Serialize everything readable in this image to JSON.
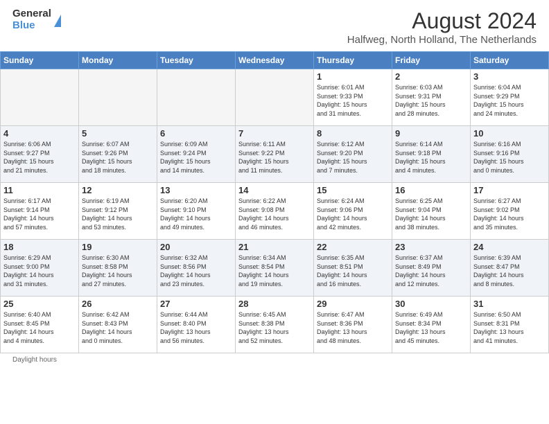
{
  "logo": {
    "general": "General",
    "blue": "Blue"
  },
  "header": {
    "month": "August 2024",
    "location": "Halfweg, North Holland, The Netherlands"
  },
  "days_of_week": [
    "Sunday",
    "Monday",
    "Tuesday",
    "Wednesday",
    "Thursday",
    "Friday",
    "Saturday"
  ],
  "footer": {
    "note": "Daylight hours"
  },
  "weeks": [
    {
      "row_alt": false,
      "days": [
        {
          "num": "",
          "info": ""
        },
        {
          "num": "",
          "info": ""
        },
        {
          "num": "",
          "info": ""
        },
        {
          "num": "",
          "info": ""
        },
        {
          "num": "1",
          "info": "Sunrise: 6:01 AM\nSunset: 9:33 PM\nDaylight: 15 hours\nand 31 minutes."
        },
        {
          "num": "2",
          "info": "Sunrise: 6:03 AM\nSunset: 9:31 PM\nDaylight: 15 hours\nand 28 minutes."
        },
        {
          "num": "3",
          "info": "Sunrise: 6:04 AM\nSunset: 9:29 PM\nDaylight: 15 hours\nand 24 minutes."
        }
      ]
    },
    {
      "row_alt": true,
      "days": [
        {
          "num": "4",
          "info": "Sunrise: 6:06 AM\nSunset: 9:27 PM\nDaylight: 15 hours\nand 21 minutes."
        },
        {
          "num": "5",
          "info": "Sunrise: 6:07 AM\nSunset: 9:26 PM\nDaylight: 15 hours\nand 18 minutes."
        },
        {
          "num": "6",
          "info": "Sunrise: 6:09 AM\nSunset: 9:24 PM\nDaylight: 15 hours\nand 14 minutes."
        },
        {
          "num": "7",
          "info": "Sunrise: 6:11 AM\nSunset: 9:22 PM\nDaylight: 15 hours\nand 11 minutes."
        },
        {
          "num": "8",
          "info": "Sunrise: 6:12 AM\nSunset: 9:20 PM\nDaylight: 15 hours\nand 7 minutes."
        },
        {
          "num": "9",
          "info": "Sunrise: 6:14 AM\nSunset: 9:18 PM\nDaylight: 15 hours\nand 4 minutes."
        },
        {
          "num": "10",
          "info": "Sunrise: 6:16 AM\nSunset: 9:16 PM\nDaylight: 15 hours\nand 0 minutes."
        }
      ]
    },
    {
      "row_alt": false,
      "days": [
        {
          "num": "11",
          "info": "Sunrise: 6:17 AM\nSunset: 9:14 PM\nDaylight: 14 hours\nand 57 minutes."
        },
        {
          "num": "12",
          "info": "Sunrise: 6:19 AM\nSunset: 9:12 PM\nDaylight: 14 hours\nand 53 minutes."
        },
        {
          "num": "13",
          "info": "Sunrise: 6:20 AM\nSunset: 9:10 PM\nDaylight: 14 hours\nand 49 minutes."
        },
        {
          "num": "14",
          "info": "Sunrise: 6:22 AM\nSunset: 9:08 PM\nDaylight: 14 hours\nand 46 minutes."
        },
        {
          "num": "15",
          "info": "Sunrise: 6:24 AM\nSunset: 9:06 PM\nDaylight: 14 hours\nand 42 minutes."
        },
        {
          "num": "16",
          "info": "Sunrise: 6:25 AM\nSunset: 9:04 PM\nDaylight: 14 hours\nand 38 minutes."
        },
        {
          "num": "17",
          "info": "Sunrise: 6:27 AM\nSunset: 9:02 PM\nDaylight: 14 hours\nand 35 minutes."
        }
      ]
    },
    {
      "row_alt": true,
      "days": [
        {
          "num": "18",
          "info": "Sunrise: 6:29 AM\nSunset: 9:00 PM\nDaylight: 14 hours\nand 31 minutes."
        },
        {
          "num": "19",
          "info": "Sunrise: 6:30 AM\nSunset: 8:58 PM\nDaylight: 14 hours\nand 27 minutes."
        },
        {
          "num": "20",
          "info": "Sunrise: 6:32 AM\nSunset: 8:56 PM\nDaylight: 14 hours\nand 23 minutes."
        },
        {
          "num": "21",
          "info": "Sunrise: 6:34 AM\nSunset: 8:54 PM\nDaylight: 14 hours\nand 19 minutes."
        },
        {
          "num": "22",
          "info": "Sunrise: 6:35 AM\nSunset: 8:51 PM\nDaylight: 14 hours\nand 16 minutes."
        },
        {
          "num": "23",
          "info": "Sunrise: 6:37 AM\nSunset: 8:49 PM\nDaylight: 14 hours\nand 12 minutes."
        },
        {
          "num": "24",
          "info": "Sunrise: 6:39 AM\nSunset: 8:47 PM\nDaylight: 14 hours\nand 8 minutes."
        }
      ]
    },
    {
      "row_alt": false,
      "days": [
        {
          "num": "25",
          "info": "Sunrise: 6:40 AM\nSunset: 8:45 PM\nDaylight: 14 hours\nand 4 minutes."
        },
        {
          "num": "26",
          "info": "Sunrise: 6:42 AM\nSunset: 8:43 PM\nDaylight: 14 hours\nand 0 minutes."
        },
        {
          "num": "27",
          "info": "Sunrise: 6:44 AM\nSunset: 8:40 PM\nDaylight: 13 hours\nand 56 minutes."
        },
        {
          "num": "28",
          "info": "Sunrise: 6:45 AM\nSunset: 8:38 PM\nDaylight: 13 hours\nand 52 minutes."
        },
        {
          "num": "29",
          "info": "Sunrise: 6:47 AM\nSunset: 8:36 PM\nDaylight: 13 hours\nand 48 minutes."
        },
        {
          "num": "30",
          "info": "Sunrise: 6:49 AM\nSunset: 8:34 PM\nDaylight: 13 hours\nand 45 minutes."
        },
        {
          "num": "31",
          "info": "Sunrise: 6:50 AM\nSunset: 8:31 PM\nDaylight: 13 hours\nand 41 minutes."
        }
      ]
    }
  ]
}
